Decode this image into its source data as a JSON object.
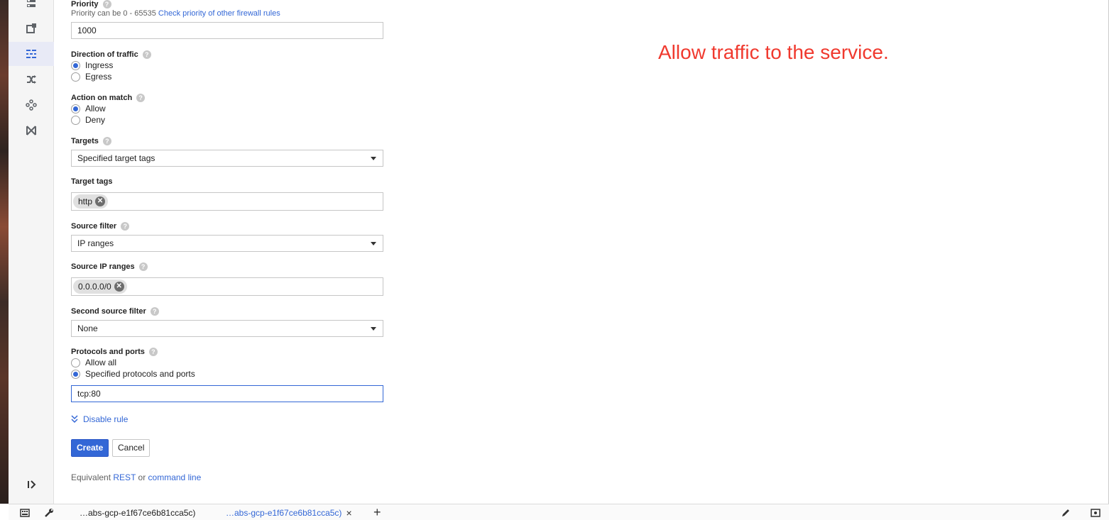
{
  "priority": {
    "label": "Priority",
    "hint_prefix": "Priority can be 0 - 65535",
    "hint_link": "Check priority of other firewall rules",
    "value": "1000"
  },
  "direction": {
    "label": "Direction of traffic",
    "options": [
      "Ingress",
      "Egress"
    ],
    "selected": "Ingress"
  },
  "action": {
    "label": "Action on match",
    "options": [
      "Allow",
      "Deny"
    ],
    "selected": "Allow"
  },
  "targets": {
    "label": "Targets",
    "value": "Specified target tags"
  },
  "target_tags": {
    "label": "Target tags",
    "chips": [
      "http"
    ]
  },
  "source_filter": {
    "label": "Source filter",
    "value": "IP ranges"
  },
  "source_ip_ranges": {
    "label": "Source IP ranges",
    "chips": [
      "0.0.0.0/0"
    ]
  },
  "second_source_filter": {
    "label": "Second source filter",
    "value": "None"
  },
  "protocols": {
    "label": "Protocols and ports",
    "options": [
      "Allow all",
      "Specified protocols and ports"
    ],
    "selected": "Specified protocols and ports",
    "value": "tcp:80"
  },
  "disable_rule": "Disable rule",
  "buttons": {
    "create": "Create",
    "cancel": "Cancel"
  },
  "equivalent": {
    "prefix": "Equivalent",
    "rest": "REST",
    "or": "or",
    "command_line": "command line"
  },
  "annotation": "Allow traffic to the service.",
  "help_glyph": "?",
  "chip_remove_glyph": "✕",
  "bottom_tabs": {
    "tab1": "…abs-gcp-e1f67ce6b81cca5c)",
    "tab2": "…abs-gcp-e1f67ce6b81cca5c)",
    "close": "×",
    "add": "+"
  },
  "colors": {
    "accent": "#3367d6",
    "annotation": "#f0392e"
  }
}
